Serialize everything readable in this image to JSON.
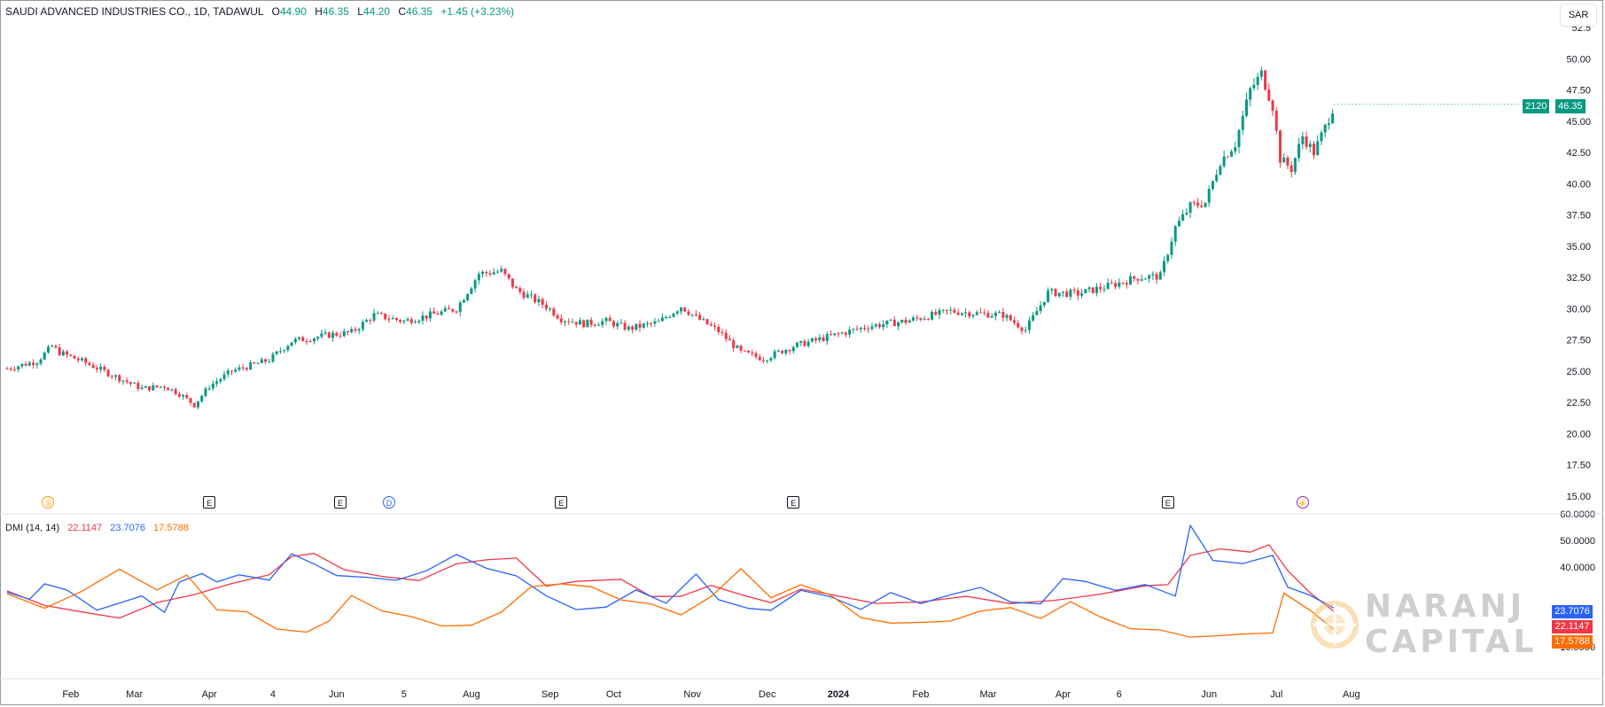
{
  "header": {
    "symbol": "SAUDI ADVANCED INDUSTRIES CO., 1D, TADAWUL",
    "open_label": "O",
    "open_value": "44.90",
    "high_label": "H",
    "high_value": "46.35",
    "low_label": "L",
    "low_value": "44.20",
    "close_label": "C",
    "close_value": "46.35",
    "change": "+1.45 (+3.23%)"
  },
  "currency": "SAR",
  "last_price": {
    "ticker": "2120",
    "value": "46.35"
  },
  "indicator": {
    "title": "DMI (14, 14)",
    "values": [
      "22.1147",
      "23.7076",
      "17.5788"
    ],
    "colors": [
      "#f23645",
      "#2962ff",
      "#ff6d00"
    ],
    "badges": [
      "23.7076",
      "22.1147",
      "17.5788"
    ],
    "badge_colors": [
      "#2962ff",
      "#f23645",
      "#ff6d00"
    ]
  },
  "events": [
    {
      "symbol": "S",
      "kind": "circle",
      "color": "#ff9800",
      "month_pos": 0.55
    },
    {
      "symbol": "E",
      "kind": "box",
      "color": "#131722",
      "month_pos": 2.7
    },
    {
      "symbol": "E",
      "kind": "box",
      "color": "#131722",
      "month_pos": 4.45
    },
    {
      "symbol": "D",
      "kind": "circle",
      "color": "#2962ff",
      "month_pos": 5.1
    },
    {
      "symbol": "E",
      "kind": "box",
      "color": "#131722",
      "month_pos": 7.4
    },
    {
      "symbol": "E",
      "kind": "box",
      "color": "#131722",
      "month_pos": 10.5
    },
    {
      "symbol": "E",
      "kind": "box",
      "color": "#131722",
      "month_pos": 15.5
    },
    {
      "symbol": "⚡",
      "kind": "circle",
      "color": "#9c27b0",
      "month_pos": 17.3
    }
  ],
  "watermark": {
    "line1": "NARANJ",
    "line2": "CAPITAL"
  },
  "chart_data": [
    {
      "type": "candlestick",
      "ylim": [
        15,
        52.5
      ],
      "price_ticks": [
        "52.5",
        "50.00",
        "47.50",
        "45.00",
        "42.50",
        "40.00",
        "37.50",
        "35.00",
        "32.50",
        "30.00",
        "27.50",
        "25.00",
        "22.50",
        "20.00",
        "17.50",
        "15.00"
      ],
      "x_ticks": [
        "Feb",
        "Mar",
        "Apr",
        "4",
        "Jun",
        "5",
        "Aug",
        "Sep",
        "Oct",
        "Nov",
        "Dec",
        "2024",
        "Feb",
        "Mar",
        "Apr",
        "6",
        "Jun",
        "Jul",
        "Aug"
      ],
      "close_path": [
        [
          0.0,
          25.2
        ],
        [
          0.4,
          25.8
        ],
        [
          0.6,
          27.0
        ],
        [
          0.7,
          26.5
        ],
        [
          1.0,
          25.8
        ],
        [
          1.4,
          24.7
        ],
        [
          1.8,
          23.6
        ],
        [
          2.1,
          23.8
        ],
        [
          2.3,
          23.2
        ],
        [
          2.5,
          22.3
        ],
        [
          2.7,
          23.8
        ],
        [
          3.0,
          25.0
        ],
        [
          3.5,
          25.9
        ],
        [
          3.8,
          27.4
        ],
        [
          4.3,
          27.9
        ],
        [
          4.6,
          28.1
        ],
        [
          4.9,
          29.5
        ],
        [
          5.3,
          29.0
        ],
        [
          5.8,
          29.7
        ],
        [
          6.0,
          30.0
        ],
        [
          6.3,
          32.8
        ],
        [
          6.6,
          33.0
        ],
        [
          6.8,
          31.5
        ],
        [
          7.2,
          30.2
        ],
        [
          7.4,
          29.2
        ],
        [
          7.7,
          28.8
        ],
        [
          8.0,
          29.0
        ],
        [
          8.3,
          28.4
        ],
        [
          8.7,
          28.9
        ],
        [
          9.0,
          30.2
        ],
        [
          9.2,
          29.3
        ],
        [
          9.5,
          28.2
        ],
        [
          9.8,
          26.5
        ],
        [
          10.1,
          26.0
        ],
        [
          10.5,
          27.0
        ],
        [
          11.0,
          27.8
        ],
        [
          11.5,
          28.6
        ],
        [
          12.0,
          29.0
        ],
        [
          12.6,
          29.8
        ],
        [
          13.0,
          29.6
        ],
        [
          13.3,
          29.5
        ],
        [
          13.6,
          28.3
        ],
        [
          13.9,
          31.3
        ],
        [
          14.3,
          31.2
        ],
        [
          14.7,
          31.8
        ],
        [
          15.1,
          32.5
        ],
        [
          15.4,
          32.6
        ],
        [
          15.6,
          36.5
        ],
        [
          15.8,
          38.2
        ],
        [
          16.0,
          38.5
        ],
        [
          16.2,
          41.8
        ],
        [
          16.4,
          43.2
        ],
        [
          16.6,
          47.5
        ],
        [
          16.75,
          48.8
        ],
        [
          16.9,
          46.2
        ],
        [
          17.0,
          42.0
        ],
        [
          17.15,
          41.2
        ],
        [
          17.3,
          43.8
        ],
        [
          17.45,
          42.5
        ],
        [
          17.6,
          44.5
        ],
        [
          17.72,
          46.35
        ]
      ]
    },
    {
      "type": "line",
      "title": "DMI (14, 14)",
      "ylim": [
        0,
        60
      ],
      "y_ticks": [
        "60.0000",
        "50.0000",
        "40.0000",
        "10.0000"
      ],
      "series": [
        {
          "name": "22.1147",
          "color": "#f23645",
          "points": [
            [
              0,
              31
            ],
            [
              0.5,
              26
            ],
            [
              1.0,
              24
            ],
            [
              1.5,
              22
            ],
            [
              2.0,
              28
            ],
            [
              2.5,
              31
            ],
            [
              3.0,
              35
            ],
            [
              3.5,
              38
            ],
            [
              3.8,
              43
            ],
            [
              4.1,
              44
            ],
            [
              4.5,
              39
            ],
            [
              5.0,
              36
            ],
            [
              5.5,
              34
            ],
            [
              6.0,
              40
            ],
            [
              6.4,
              44
            ],
            [
              6.8,
              43
            ],
            [
              7.2,
              32
            ],
            [
              7.6,
              36
            ],
            [
              8.2,
              34
            ],
            [
              8.6,
              30
            ],
            [
              9.0,
              29
            ],
            [
              9.4,
              32
            ],
            [
              9.8,
              31
            ],
            [
              10.2,
              26
            ],
            [
              10.6,
              31
            ],
            [
              11.0,
              31
            ],
            [
              11.6,
              25
            ],
            [
              12.2,
              28
            ],
            [
              12.8,
              28
            ],
            [
              13.4,
              27
            ],
            [
              14.0,
              27
            ],
            [
              14.6,
              30
            ],
            [
              15.2,
              33
            ],
            [
              15.5,
              32
            ],
            [
              15.8,
              44
            ],
            [
              16.2,
              46
            ],
            [
              16.6,
              47
            ],
            [
              16.85,
              47
            ],
            [
              17.1,
              40
            ],
            [
              17.4,
              30
            ],
            [
              17.72,
              22.1
            ]
          ]
        },
        {
          "name": "23.7076",
          "color": "#2962ff",
          "points": [
            [
              0,
              32
            ],
            [
              0.3,
              28
            ],
            [
              0.5,
              35
            ],
            [
              0.8,
              31
            ],
            [
              1.2,
              25
            ],
            [
              1.8,
              28
            ],
            [
              2.1,
              22
            ],
            [
              2.3,
              33
            ],
            [
              2.6,
              37
            ],
            [
              2.8,
              33
            ],
            [
              3.1,
              37
            ],
            [
              3.5,
              34
            ],
            [
              3.8,
              44
            ],
            [
              4.1,
              42
            ],
            [
              4.4,
              38
            ],
            [
              4.8,
              36
            ],
            [
              5.2,
              34
            ],
            [
              5.6,
              40
            ],
            [
              6.0,
              44
            ],
            [
              6.4,
              39
            ],
            [
              6.8,
              38
            ],
            [
              7.2,
              28
            ],
            [
              7.6,
              24
            ],
            [
              8.0,
              26
            ],
            [
              8.4,
              30
            ],
            [
              8.8,
              27
            ],
            [
              9.2,
              38
            ],
            [
              9.5,
              29
            ],
            [
              9.9,
              24
            ],
            [
              10.2,
              25
            ],
            [
              10.6,
              30
            ],
            [
              11.0,
              29
            ],
            [
              11.4,
              25
            ],
            [
              11.8,
              29
            ],
            [
              12.2,
              27
            ],
            [
              12.6,
              30
            ],
            [
              13.0,
              31
            ],
            [
              13.4,
              28
            ],
            [
              13.8,
              26
            ],
            [
              14.1,
              37
            ],
            [
              14.4,
              35
            ],
            [
              14.8,
              32
            ],
            [
              15.2,
              32
            ],
            [
              15.6,
              30
            ],
            [
              15.8,
              57
            ],
            [
              16.1,
              43
            ],
            [
              16.5,
              42
            ],
            [
              16.9,
              43
            ],
            [
              17.1,
              32
            ],
            [
              17.4,
              28
            ],
            [
              17.72,
              23.7
            ]
          ]
        },
        {
          "name": "17.5788",
          "color": "#ff6d00",
          "points": [
            [
              0,
              30
            ],
            [
              0.5,
              24
            ],
            [
              1.0,
              30
            ],
            [
              1.5,
              38
            ],
            [
              2.0,
              30
            ],
            [
              2.4,
              38
            ],
            [
              2.8,
              24
            ],
            [
              3.2,
              22
            ],
            [
              3.6,
              18
            ],
            [
              4.0,
              15
            ],
            [
              4.3,
              21
            ],
            [
              4.6,
              30
            ],
            [
              5.0,
              24
            ],
            [
              5.4,
              20
            ],
            [
              5.8,
              19
            ],
            [
              6.2,
              18
            ],
            [
              6.6,
              22
            ],
            [
              7.0,
              34
            ],
            [
              7.4,
              33
            ],
            [
              7.8,
              32
            ],
            [
              8.2,
              29
            ],
            [
              8.6,
              25
            ],
            [
              9.0,
              22
            ],
            [
              9.4,
              30
            ],
            [
              9.8,
              38
            ],
            [
              10.2,
              29
            ],
            [
              10.6,
              34
            ],
            [
              11.0,
              28
            ],
            [
              11.4,
              22
            ],
            [
              11.8,
              19
            ],
            [
              12.2,
              18
            ],
            [
              12.6,
              21
            ],
            [
              13.0,
              23
            ],
            [
              13.4,
              24
            ],
            [
              13.8,
              22
            ],
            [
              14.2,
              26
            ],
            [
              14.6,
              21
            ],
            [
              15.0,
              18
            ],
            [
              15.4,
              15
            ],
            [
              15.8,
              14
            ],
            [
              16.2,
              15
            ],
            [
              16.5,
              16
            ],
            [
              16.9,
              15
            ],
            [
              17.05,
              31
            ],
            [
              17.4,
              24
            ],
            [
              17.72,
              17.6
            ]
          ]
        }
      ]
    }
  ]
}
